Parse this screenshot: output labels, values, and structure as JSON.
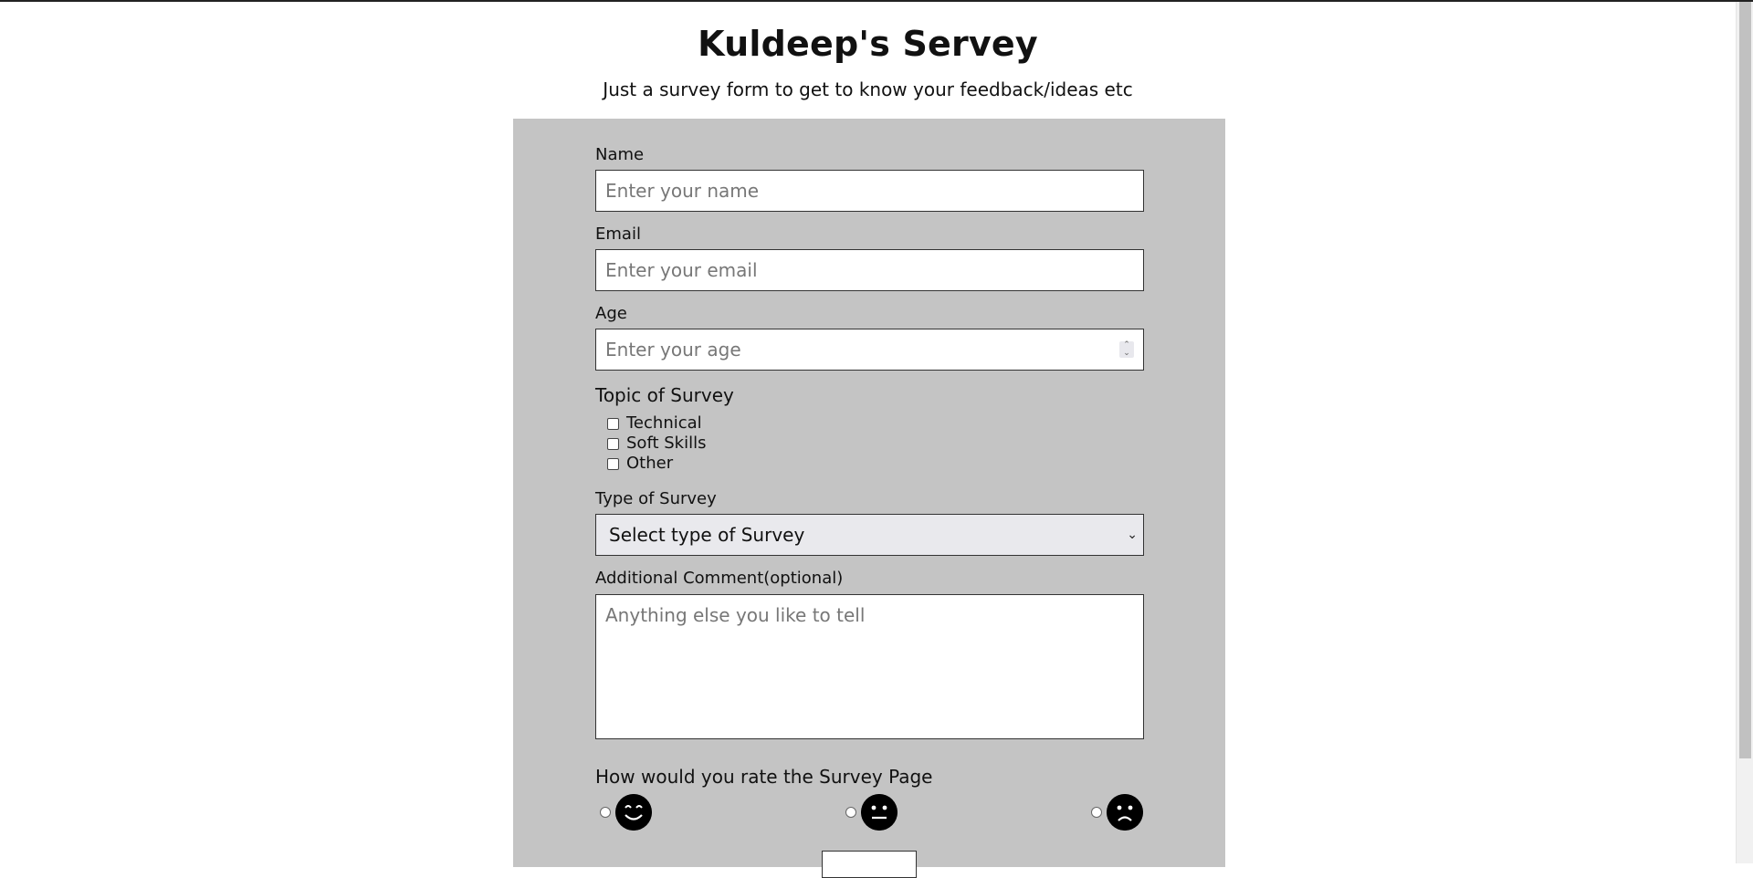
{
  "header": {
    "title": "Kuldeep's Servey",
    "subtitle": "Just a survey form to get to know your feedback/ideas etc"
  },
  "form": {
    "name": {
      "label": "Name",
      "placeholder": "Enter your name"
    },
    "email": {
      "label": "Email",
      "placeholder": "Enter your email"
    },
    "age": {
      "label": "Age",
      "placeholder": "Enter your age"
    },
    "topic": {
      "label": "Topic of Survey",
      "options": [
        "Technical",
        "Soft Skills",
        "Other"
      ]
    },
    "type": {
      "label": "Type of Survey",
      "selected": "Select type of Survey"
    },
    "comment": {
      "label": "Additional Comment(optional)",
      "placeholder": "Anything else you like to tell"
    },
    "rating": {
      "label": "How would you rate the Survey Page",
      "options": [
        "smiling-face-icon",
        "neutral-face-icon",
        "sad-face-icon"
      ]
    }
  }
}
